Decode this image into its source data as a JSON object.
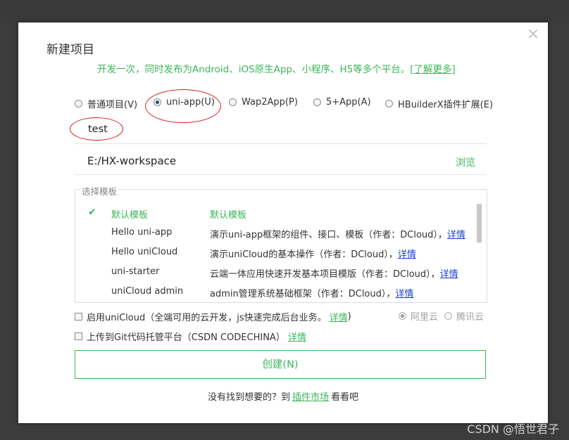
{
  "dialog": {
    "title": "新建项目",
    "close_icon": "×",
    "subtitle": "开发一次，同时发布为Android、iOS原生App、小程序、H5等多个平台。",
    "learn_more": "[了解更多]"
  },
  "project_types": [
    {
      "label": "普通项目(V)",
      "selected": false
    },
    {
      "label": "uni-app(U)",
      "selected": true
    },
    {
      "label": "Wap2App(P)",
      "selected": false
    },
    {
      "label": "5+App(A)",
      "selected": false
    },
    {
      "label": "HBuilderX插件扩展(E)",
      "selected": false
    }
  ],
  "project_name": "test",
  "project_path": "E:/HX-workspace",
  "browse_label": "浏览",
  "templates": {
    "legend": "选择模板",
    "rows": [
      {
        "name": "默认模板",
        "desc": "默认模板",
        "link": "",
        "selected": true
      },
      {
        "name": "Hello uni-app",
        "desc": "演示uni-app框架的组件、接口、模板（作者：DCloud），",
        "link": "详情",
        "selected": false
      },
      {
        "name": "Hello uniCloud",
        "desc": "演示uniCloud的基本操作（作者：DCloud），",
        "link": "详情",
        "selected": false
      },
      {
        "name": "uni-starter",
        "desc": "云端一体应用快速开发基本项目模版（作者：DCloud），",
        "link": "详情",
        "selected": false
      },
      {
        "name": "uniCloud admin",
        "desc": "admin管理系统基础框架（作者：DCloud），",
        "link": "详情",
        "selected": false
      }
    ]
  },
  "unicloud": {
    "label": "启用uniCloud（全端可用的云开发，js快速完成后台业务。",
    "link": "详情",
    "suffix": ")",
    "providers": [
      "阿里云",
      "腾讯云"
    ]
  },
  "git": {
    "label": "上传到Git代码托管平台（CSDN CODECHINA）",
    "link": "详情"
  },
  "create_button": "创建(N)",
  "footer": {
    "prefix": "没有找到想要的？到",
    "link": "插件市场",
    "suffix": "看看吧"
  },
  "watermark": "CSDN @悟世君子",
  "colors": {
    "accent": "#3cb55a",
    "annotation": "#d61f1f",
    "link": "#1a3fd6"
  }
}
